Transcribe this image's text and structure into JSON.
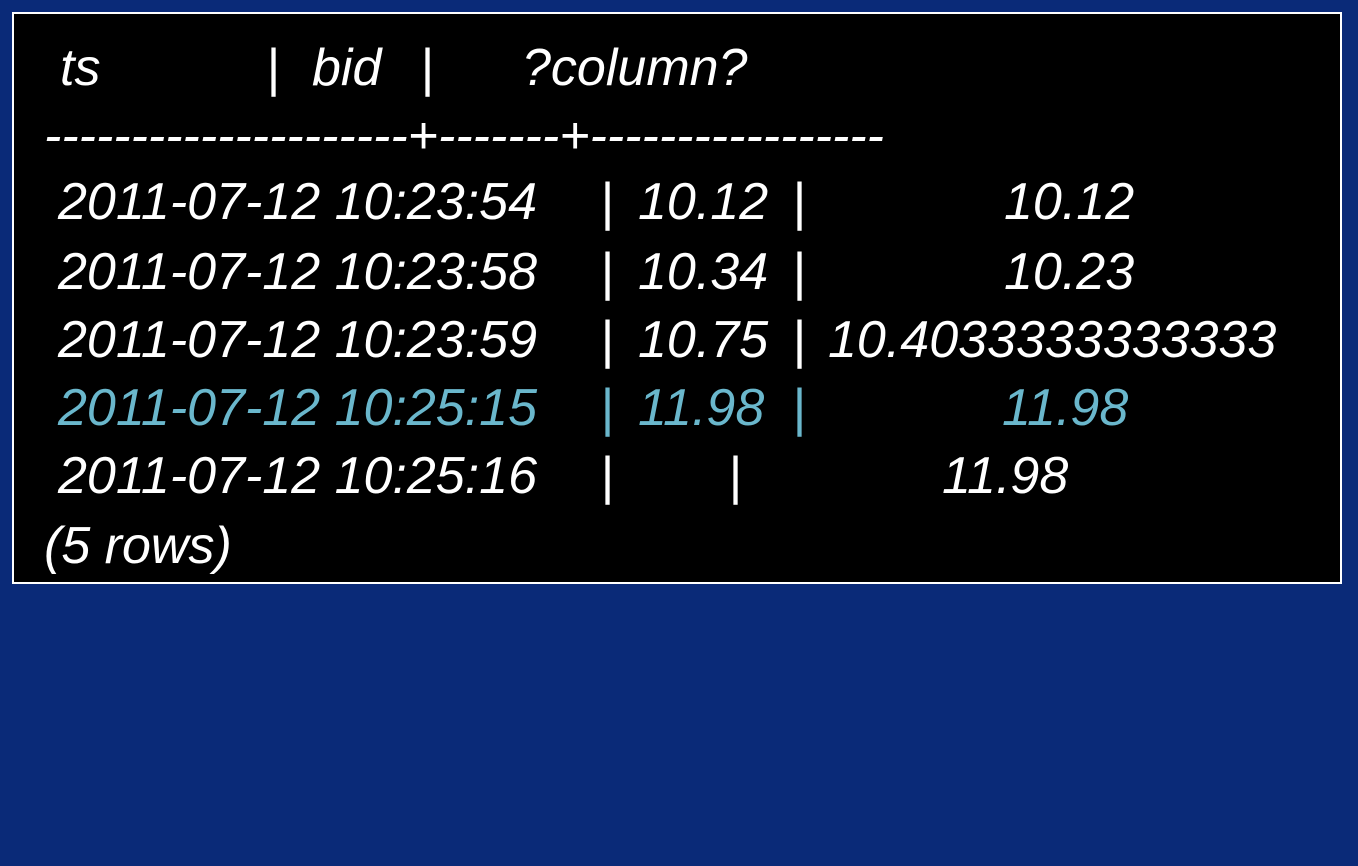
{
  "colors": {
    "background": "#0a2a78",
    "terminal": "#000000",
    "text": "#ffffff",
    "highlight": "#6ab7cc"
  },
  "header": {
    "ts": "ts",
    "sep1": "|",
    "bid": "bid",
    "sep2": "|",
    "column": "?column?"
  },
  "divider": "---------------------+-------+-----------------",
  "rows": [
    {
      "ts": "2011-07-12 10:23:54",
      "sep1": "|",
      "bid": "10.12",
      "sep2": "|",
      "value": "10.12"
    },
    {
      "ts": "2011-07-12 10:23:58",
      "sep1": "|",
      "bid": "10.34",
      "sep2": "|",
      "value": "10.23"
    },
    {
      "ts": "2011-07-12 10:23:59",
      "sep1": "|",
      "bid": "10.75",
      "sep2": "|",
      "value": "10.4033333333333"
    },
    {
      "ts": "2011-07-12 10:25:15",
      "sep1": "|",
      "bid": "11.98",
      "sep2": "|",
      "value": "11.98"
    },
    {
      "ts": "2011-07-12 10:25:16",
      "sep1": "|",
      "bid": "",
      "sep2": "|",
      "value": "11.98"
    }
  ],
  "footer": "(5 rows)"
}
